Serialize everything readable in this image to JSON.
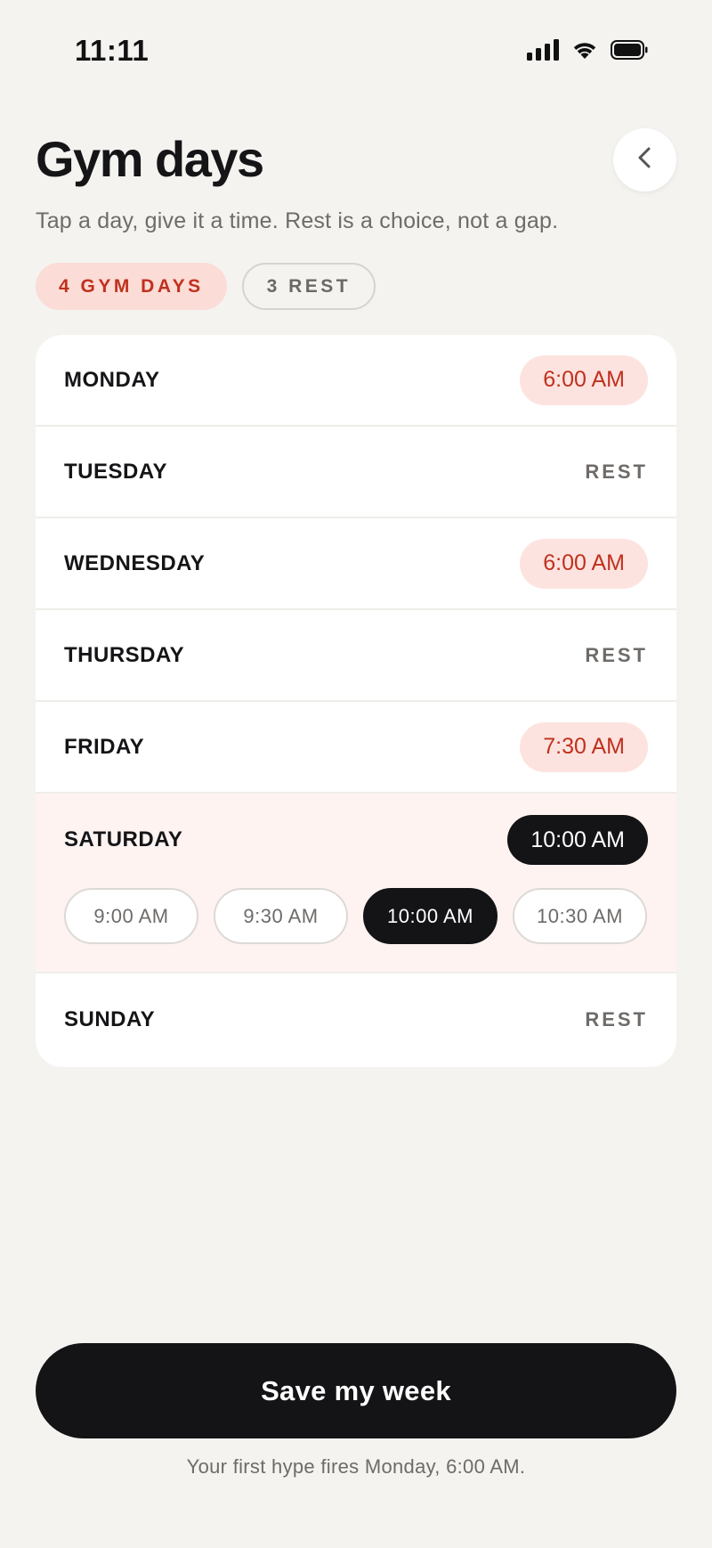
{
  "status_bar": {
    "time": "11:11"
  },
  "header": {
    "title": "Gym days",
    "subtitle": "Tap a day, give it a time. Rest is a choice, not a gap."
  },
  "summary": {
    "gym_days": "4 GYM DAYS",
    "rest_days": "3 REST"
  },
  "days": [
    {
      "name": "MONDAY",
      "value": "6:00 AM",
      "type": "gym"
    },
    {
      "name": "TUESDAY",
      "value": "REST",
      "type": "rest"
    },
    {
      "name": "WEDNESDAY",
      "value": "6:00 AM",
      "type": "gym"
    },
    {
      "name": "THURSDAY",
      "value": "REST",
      "type": "rest"
    },
    {
      "name": "FRIDAY",
      "value": "7:30 AM",
      "type": "gym"
    },
    {
      "name": "SATURDAY",
      "value": "10:00 AM",
      "type": "gym-editing"
    },
    {
      "name": "SUNDAY",
      "value": "REST",
      "type": "rest"
    }
  ],
  "time_options": [
    "9:00 AM",
    "9:30 AM",
    "10:00 AM",
    "10:30 AM"
  ],
  "selected_time_option": "10:00 AM",
  "footer": {
    "save_label": "Save my week",
    "note": "Your first hype fires Monday, 6:00 AM."
  },
  "colors": {
    "background": "#f4f3f0",
    "accent": "#c0311f",
    "accent_soft": "#fde3df",
    "dark": "#141316",
    "expanded_row": "#fef3f1"
  },
  "icons": {
    "back": "chevron-left-icon",
    "signal": "cellular-signal-icon",
    "wifi": "wifi-icon",
    "battery": "battery-icon"
  }
}
